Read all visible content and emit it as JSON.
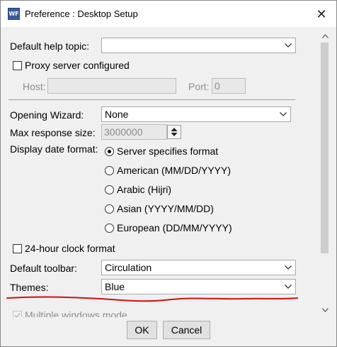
{
  "window": {
    "app_icon_text": "WF",
    "title": "Preference : Desktop Setup",
    "close_glyph": "✕"
  },
  "form": {
    "default_help_topic": {
      "label": "Default help topic:",
      "value": ""
    },
    "proxy": {
      "label": "Proxy server configured",
      "checked": false,
      "host_label": "Host:",
      "host_value": "",
      "port_label": "Port:",
      "port_value": "0"
    },
    "opening_wizard": {
      "label": "Opening Wizard:",
      "value": "None"
    },
    "max_response_size": {
      "label": "Max response size:",
      "value": "3000000"
    },
    "display_date_format": {
      "label": "Display date format:",
      "options": [
        {
          "label": "Server specifies format",
          "selected": true
        },
        {
          "label": "American (MM/DD/YYYY)",
          "selected": false
        },
        {
          "label": "Arabic (Hijri)",
          "selected": false
        },
        {
          "label": "Asian (YYYY/MM/DD)",
          "selected": false
        },
        {
          "label": "European (DD/MM/YYYY)",
          "selected": false
        }
      ]
    },
    "clock_24h": {
      "label": "24-hour clock format",
      "checked": false
    },
    "default_toolbar": {
      "label": "Default toolbar:",
      "value": "Circulation"
    },
    "themes": {
      "label": "Themes:",
      "value": "Blue"
    },
    "multiple_windows": {
      "label": "Multiple windows mode",
      "checked": true
    }
  },
  "buttons": {
    "ok": "OK",
    "cancel": "Cancel"
  },
  "colors": {
    "annotation_underline": "#d01010"
  },
  "icons": {
    "close": "close-icon",
    "dropdown": "chevron-down-icon",
    "spinner": "spinner-arrows-icon",
    "scroll_up": "scroll-up-arrow-icon",
    "scroll_down": "scroll-down-arrow-icon"
  }
}
